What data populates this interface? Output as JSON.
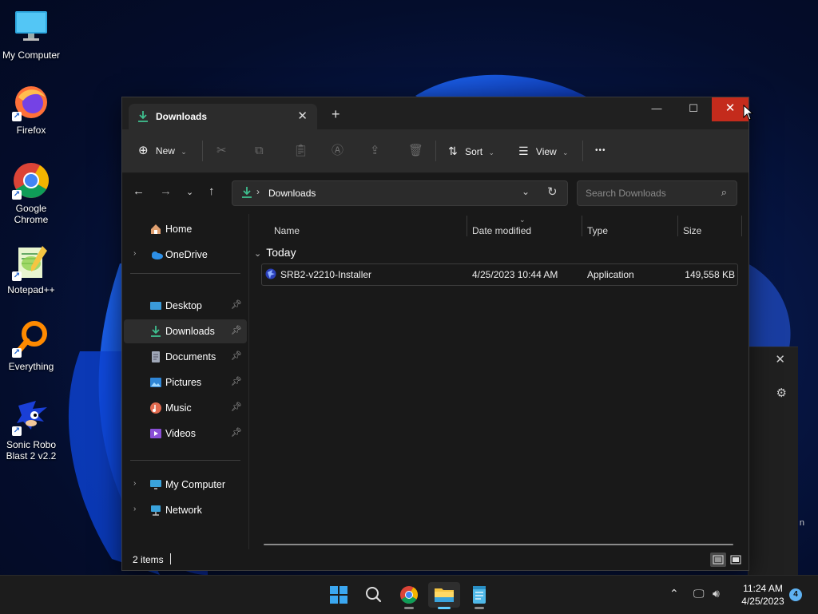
{
  "desktop": {
    "icons": [
      {
        "label": "My Computer"
      },
      {
        "label": "Firefox"
      },
      {
        "label": "Google Chrome"
      },
      {
        "label": "Notepad++"
      },
      {
        "label": "Everything"
      },
      {
        "label": "Sonic Robo Blast 2 v2.2"
      }
    ]
  },
  "window": {
    "tab_title": "Downloads",
    "toolbar": {
      "new_label": "New",
      "sort_label": "Sort",
      "view_label": "View",
      "more_label": "•••"
    },
    "address": {
      "path": "Downloads",
      "search_placeholder": "Search Downloads"
    },
    "nav": {
      "top": [
        {
          "label": "Home"
        },
        {
          "label": "OneDrive"
        }
      ],
      "quick": [
        {
          "label": "Desktop"
        },
        {
          "label": "Downloads"
        },
        {
          "label": "Documents"
        },
        {
          "label": "Pictures"
        },
        {
          "label": "Music"
        },
        {
          "label": "Videos"
        }
      ],
      "bottom": [
        {
          "label": "My Computer"
        },
        {
          "label": "Network"
        }
      ]
    },
    "columns": {
      "name": "Name",
      "date": "Date modified",
      "type": "Type",
      "size": "Size"
    },
    "group_label": "Today",
    "files": [
      {
        "name": "SRB2-v2210-Installer",
        "date": "4/25/2023 10:44 AM",
        "type": "Application",
        "size": "149,558 KB"
      }
    ],
    "status_text": "2 items"
  },
  "flyout": {
    "tail_text": "n"
  },
  "taskbar": {
    "time": "11:24 AM",
    "date": "4/25/2023",
    "notification_count": "4"
  },
  "colors": {
    "accent": "#60cdff",
    "close_red": "#c42b1c",
    "download_green": "#3fbf8f"
  }
}
